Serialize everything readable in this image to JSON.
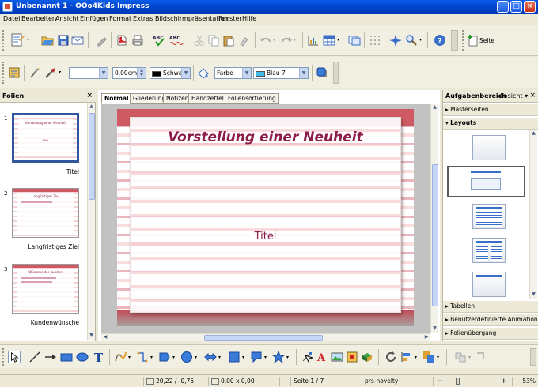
{
  "window": {
    "title": "Unbenannt 1 - OOo4Kids Impress"
  },
  "menu": [
    "Datei",
    "Bearbeiten",
    "Ansicht",
    "Einfügen",
    "Format",
    "Extras",
    "Bildschirmpräsentation",
    "Fenster",
    "Hilfe"
  ],
  "toolbar": {
    "seite_label": "Seite"
  },
  "format_toolbar": {
    "line_width": "0,00cm",
    "line_color": "Schwar",
    "area_style": "Farbe",
    "area_color": "Blau 7",
    "line_color_hex": "#000000",
    "area_color_hex": "#3fbbe8"
  },
  "slides_pane": {
    "title": "Folien",
    "slides": [
      {
        "num": "1",
        "label": "Titel",
        "thumb_title": "Vorstellung einer Neuheit",
        "thumb_sub": "Titel"
      },
      {
        "num": "2",
        "label": "Langfristiges Ziel",
        "thumb_title": "Langfristiges Ziel",
        "thumb_sub": ""
      },
      {
        "num": "3",
        "label": "Kundenwünsche",
        "thumb_title": "Wünsche der Kunden",
        "thumb_sub": ""
      }
    ]
  },
  "view_tabs": [
    "Normal",
    "Gliederung",
    "Notizen",
    "Handzettel",
    "Foliensortierung"
  ],
  "slide": {
    "title": "Vorstellung einer Neuheit",
    "subtitle": "Titel",
    "accent": "#8b1d48"
  },
  "task_pane": {
    "title": "Aufgabenbereich",
    "view_label": "Ansicht",
    "sections_top": [
      "Masterseiten",
      "Layouts"
    ],
    "sections_bottom": [
      "Tabellen",
      "Benutzerdefinierte Animation",
      "Folienübergang"
    ]
  },
  "status": {
    "position": "20,22 / -0,75",
    "size": "0,00 x 0,00",
    "page": "Seite 1 / 7",
    "master": "prs-novelty",
    "zoom": "53%"
  }
}
